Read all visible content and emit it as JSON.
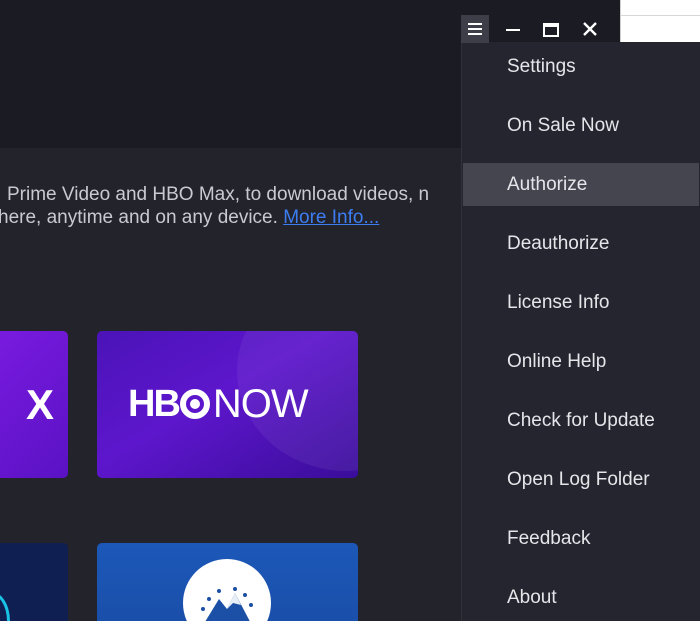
{
  "window_controls": {
    "menu_icon": "hamburger-menu-icon",
    "minimize_icon": "minimize-icon",
    "maximize_icon": "maximize-icon",
    "close_icon": "close-icon"
  },
  "description": {
    "line1": " Prime Video and HBO Max, to download videos, n",
    "line2": "here, anytime and on any device. ",
    "more_info_link": "More Info..."
  },
  "services": [
    {
      "name": "partial-purple-service-tile",
      "logo_fragment": "X"
    },
    {
      "name": "hbo-now-tile",
      "logo_bold": "HB",
      "logo_rest": "NOW"
    },
    {
      "name": "partial-dark-service-tile"
    },
    {
      "name": "paramount-tile"
    }
  ],
  "menu": {
    "items": [
      {
        "label": "Settings"
      },
      {
        "label": "On Sale Now"
      },
      {
        "label": "Authorize",
        "highlighted": true
      },
      {
        "label": "Deauthorize"
      },
      {
        "label": "License Info"
      },
      {
        "label": "Online Help"
      },
      {
        "label": "Check for Update"
      },
      {
        "label": "Open Log Folder"
      },
      {
        "label": "Feedback"
      },
      {
        "label": "About"
      }
    ]
  },
  "colors": {
    "background": "#22232b",
    "header": "#1b1c23",
    "menu_bg": "#24252e",
    "menu_highlight": "#44454f",
    "link": "#3d7df2",
    "hbo_tile": "#5d16cc",
    "paramount_tile": "#1c58b8"
  }
}
